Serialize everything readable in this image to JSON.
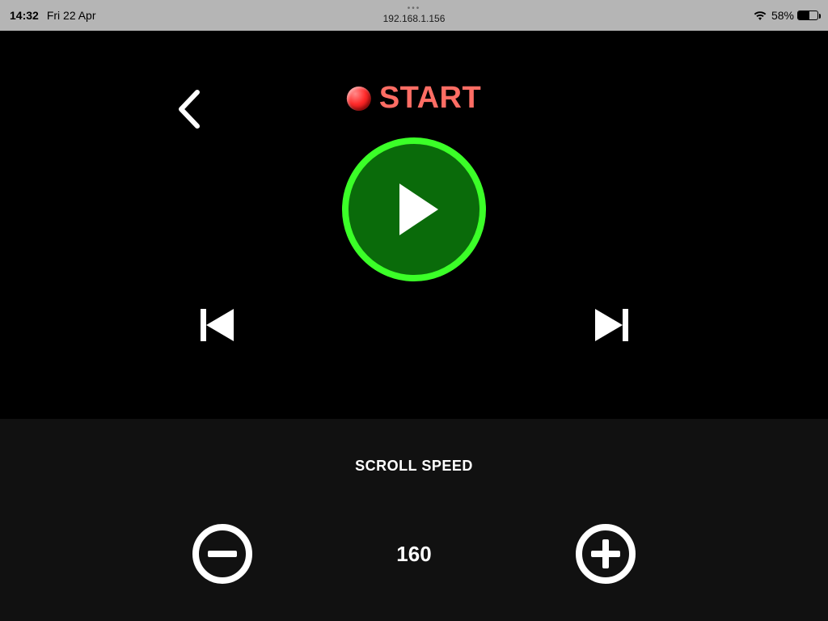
{
  "status": {
    "time": "14:32",
    "date": "Fri 22 Apr",
    "address": "192.168.1.156",
    "battery_pct": "58%"
  },
  "header": {
    "start_label": "START"
  },
  "lower": {
    "scroll_label": "SCROLL SPEED",
    "speed_value": "160"
  }
}
